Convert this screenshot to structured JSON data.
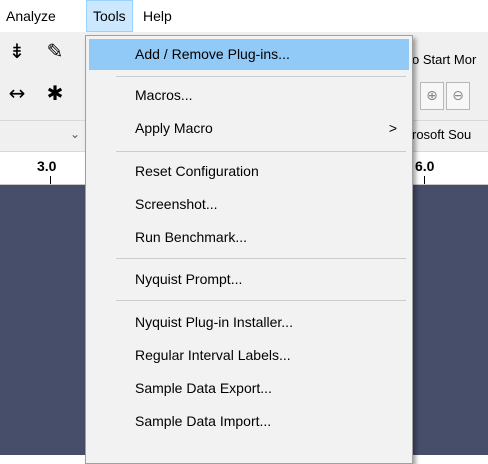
{
  "menubar": {
    "items": [
      "Analyze",
      "Tools",
      "Help"
    ]
  },
  "toolbar": {
    "tools": [
      {
        "icon": "envelope-tool-icon",
        "glyph": "⇟"
      },
      {
        "icon": "draw-tool-icon",
        "glyph": "✎"
      },
      {
        "icon": "zoom-tool-icon",
        "glyph": "↔"
      },
      {
        "icon": "multi-tool-icon",
        "glyph": "✱"
      }
    ],
    "right_fragments": {
      "start_monitoring": "o Start Mor",
      "device": "rosoft Sou"
    }
  },
  "ruler": {
    "labels": [
      "3.0",
      "6.0"
    ]
  },
  "tools_menu": {
    "items": [
      "Add / Remove Plug-ins...",
      "Macros...",
      "Apply Macro",
      "Reset Configuration",
      "Screenshot...",
      "Run Benchmark...",
      "Nyquist Prompt...",
      "Nyquist Plug-in Installer...",
      "Regular Interval Labels...",
      "Sample Data Export...",
      "Sample Data Import..."
    ],
    "submenu_arrow": ">"
  },
  "colors": {
    "menu_bg": "#f2f2f2",
    "menu_highlight": "#91c9f7",
    "track_bg": "#474e6a",
    "open_menu_bg": "#cce8ff"
  }
}
